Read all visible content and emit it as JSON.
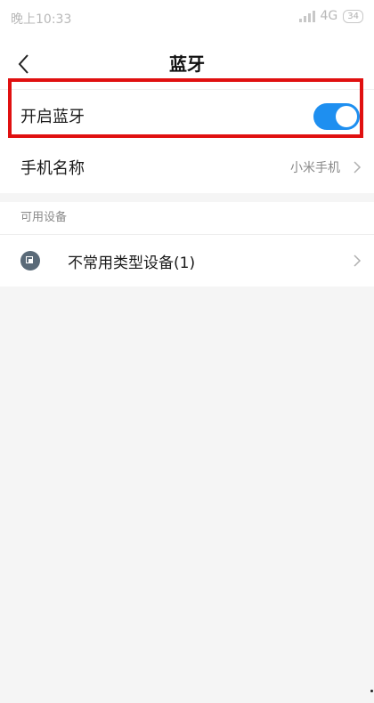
{
  "status_bar": {
    "time": "晚上10:33",
    "network": "4G",
    "battery": "34"
  },
  "nav": {
    "title": "蓝牙"
  },
  "settings": {
    "bluetooth_toggle_label": "开启蓝牙",
    "bluetooth_enabled": true,
    "device_name_label": "手机名称",
    "device_name_value": "小米手机"
  },
  "available_devices": {
    "section_title": "可用设备",
    "items": [
      {
        "label": "不常用类型设备(1)"
      }
    ]
  },
  "colors": {
    "toggle_on": "#1e8ff0",
    "highlight": "#e01010",
    "background": "#f5f5f5"
  }
}
